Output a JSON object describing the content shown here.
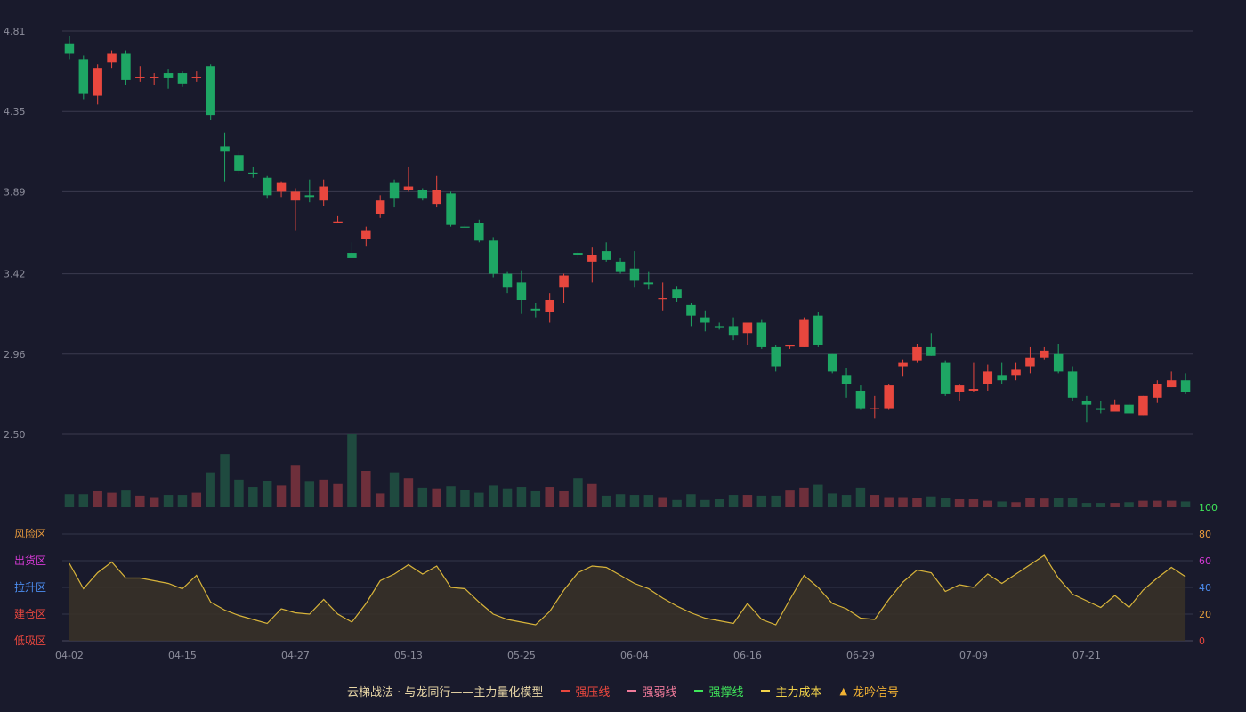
{
  "chart_data": [
    {
      "type": "candlestick",
      "price_axis_ticks": [
        "4.81",
        "4.35",
        "3.89",
        "3.42",
        "2.96",
        "2.50"
      ],
      "ylim": [
        2.5,
        4.81
      ],
      "x_tick_labels": [
        "04-02",
        "04-15",
        "04-27",
        "05-13",
        "05-25",
        "06-04",
        "06-16",
        "06-29",
        "07-09",
        "07-21"
      ],
      "x_tick_bar_index": [
        0,
        8,
        16,
        24,
        32,
        40,
        48,
        56,
        64,
        72
      ],
      "colors": {
        "up": "#e8473e",
        "down": "#1ea664",
        "vol_up": "#6e2f3b",
        "vol_down": "#1f4a3f"
      },
      "bars": [
        [
          4.74,
          4.68,
          4.78,
          4.65,
          0
        ],
        [
          4.65,
          4.45,
          4.67,
          4.42,
          0
        ],
        [
          4.44,
          4.6,
          4.62,
          4.39,
          1
        ],
        [
          4.63,
          4.68,
          4.7,
          4.6,
          1
        ],
        [
          4.68,
          4.53,
          4.7,
          4.5,
          0
        ],
        [
          4.54,
          4.55,
          4.61,
          4.52,
          1
        ],
        [
          4.54,
          4.55,
          4.57,
          4.5,
          1
        ],
        [
          4.57,
          4.54,
          4.59,
          4.48,
          0
        ],
        [
          4.57,
          4.51,
          4.58,
          4.49,
          0
        ],
        [
          4.54,
          4.55,
          4.58,
          4.52,
          1
        ],
        [
          4.61,
          4.33,
          4.62,
          4.3,
          0
        ],
        [
          4.15,
          4.12,
          4.23,
          3.95,
          0
        ],
        [
          4.1,
          4.01,
          4.12,
          3.99,
          0
        ],
        [
          4.0,
          3.99,
          4.03,
          3.97,
          0
        ],
        [
          3.97,
          3.87,
          3.98,
          3.85,
          0
        ],
        [
          3.89,
          3.94,
          3.95,
          3.86,
          1
        ],
        [
          3.84,
          3.89,
          3.91,
          3.67,
          1
        ],
        [
          3.87,
          3.86,
          3.96,
          3.83,
          0
        ],
        [
          3.84,
          3.92,
          3.96,
          3.81,
          1
        ],
        [
          3.71,
          3.72,
          3.75,
          3.71,
          1
        ],
        [
          3.54,
          3.51,
          3.6,
          3.51,
          0
        ],
        [
          3.62,
          3.67,
          3.69,
          3.58,
          1
        ],
        [
          3.76,
          3.84,
          3.87,
          3.74,
          1
        ],
        [
          3.85,
          3.94,
          3.96,
          3.8,
          0
        ],
        [
          3.9,
          3.92,
          4.03,
          3.89,
          1
        ],
        [
          3.9,
          3.85,
          3.91,
          3.84,
          0
        ],
        [
          3.82,
          3.9,
          3.98,
          3.8,
          1
        ],
        [
          3.88,
          3.7,
          3.89,
          3.69,
          0
        ],
        [
          3.69,
          3.69,
          3.7,
          3.69,
          0
        ],
        [
          3.71,
          3.61,
          3.73,
          3.6,
          0
        ],
        [
          3.61,
          3.42,
          3.63,
          3.4,
          0
        ],
        [
          3.42,
          3.34,
          3.43,
          3.31,
          0
        ],
        [
          3.37,
          3.27,
          3.44,
          3.19,
          0
        ],
        [
          3.22,
          3.21,
          3.25,
          3.17,
          0
        ],
        [
          3.2,
          3.27,
          3.31,
          3.14,
          1
        ],
        [
          3.34,
          3.41,
          3.42,
          3.25,
          1
        ],
        [
          3.54,
          3.53,
          3.55,
          3.51,
          0
        ],
        [
          3.49,
          3.53,
          3.57,
          3.37,
          1
        ],
        [
          3.55,
          3.5,
          3.6,
          3.49,
          0
        ],
        [
          3.49,
          3.43,
          3.51,
          3.42,
          0
        ],
        [
          3.45,
          3.38,
          3.55,
          3.34,
          0
        ],
        [
          3.37,
          3.36,
          3.43,
          3.33,
          0
        ],
        [
          3.28,
          3.28,
          3.37,
          3.21,
          1
        ],
        [
          3.33,
          3.28,
          3.35,
          3.26,
          0
        ],
        [
          3.24,
          3.18,
          3.25,
          3.12,
          0
        ],
        [
          3.17,
          3.14,
          3.21,
          3.09,
          0
        ],
        [
          3.12,
          3.12,
          3.14,
          3.1,
          0
        ],
        [
          3.12,
          3.07,
          3.17,
          3.04,
          0
        ],
        [
          3.08,
          3.14,
          3.14,
          3.01,
          1
        ],
        [
          3.14,
          3.0,
          3.16,
          2.99,
          0
        ],
        [
          3.0,
          2.89,
          3.01,
          2.86,
          0
        ],
        [
          3.01,
          3.01,
          3.01,
          2.99,
          1
        ],
        [
          3.0,
          3.16,
          3.17,
          3.0,
          1
        ],
        [
          3.18,
          3.01,
          3.2,
          3.0,
          0
        ],
        [
          2.96,
          2.86,
          2.96,
          2.85,
          0
        ],
        [
          2.84,
          2.79,
          2.88,
          2.71,
          0
        ],
        [
          2.75,
          2.65,
          2.78,
          2.64,
          0
        ],
        [
          2.65,
          2.65,
          2.72,
          2.59,
          1
        ],
        [
          2.65,
          2.78,
          2.79,
          2.64,
          1
        ],
        [
          2.89,
          2.91,
          2.93,
          2.83,
          1
        ],
        [
          2.92,
          3.0,
          3.02,
          2.91,
          1
        ],
        [
          3.0,
          2.95,
          3.08,
          2.95,
          0
        ],
        [
          2.91,
          2.73,
          2.92,
          2.72,
          0
        ],
        [
          2.74,
          2.78,
          2.79,
          2.69,
          1
        ],
        [
          2.76,
          2.75,
          2.91,
          2.74,
          1
        ],
        [
          2.79,
          2.86,
          2.9,
          2.75,
          1
        ],
        [
          2.84,
          2.81,
          2.91,
          2.79,
          0
        ],
        [
          2.84,
          2.87,
          2.91,
          2.81,
          1
        ],
        [
          2.89,
          2.94,
          3.0,
          2.85,
          1
        ],
        [
          2.94,
          2.98,
          3.0,
          2.93,
          1
        ],
        [
          2.96,
          2.86,
          3.02,
          2.85,
          0
        ],
        [
          2.86,
          2.71,
          2.89,
          2.69,
          0
        ],
        [
          2.69,
          2.67,
          2.72,
          2.57,
          0
        ],
        [
          2.65,
          2.64,
          2.69,
          2.62,
          0
        ],
        [
          2.63,
          2.67,
          2.7,
          2.63,
          1
        ],
        [
          2.67,
          2.62,
          2.68,
          2.62,
          0
        ],
        [
          2.61,
          2.72,
          2.72,
          2.61,
          1
        ],
        [
          2.71,
          2.79,
          2.81,
          2.68,
          1
        ],
        [
          2.77,
          2.81,
          2.86,
          2.77,
          1
        ],
        [
          2.81,
          2.74,
          2.85,
          2.73,
          0
        ]
      ],
      "volume": [
        18,
        18,
        22,
        20,
        23,
        16,
        14,
        17,
        17,
        20,
        48,
        73,
        38,
        28,
        36,
        30,
        57,
        35,
        38,
        32,
        100,
        50,
        19,
        48,
        40,
        27,
        26,
        29,
        24,
        20,
        30,
        26,
        28,
        22,
        28,
        22,
        40,
        32,
        16,
        18,
        17,
        17,
        14,
        10,
        18,
        10,
        11,
        17,
        17,
        16,
        16,
        23,
        27,
        31,
        19,
        17,
        27,
        17,
        14,
        14,
        13,
        15,
        13,
        11,
        11,
        9,
        8,
        7,
        13,
        12,
        13,
        13,
        6,
        6,
        6,
        7,
        9,
        9,
        9,
        8
      ]
    },
    {
      "type": "line",
      "ylim": [
        0,
        100
      ],
      "y_ticks": [
        "0",
        "20",
        "40",
        "60",
        "80",
        "100"
      ],
      "y_tick_colors": [
        "#e8473e",
        "#e8a13c",
        "#4c8df0",
        "#d63ad6",
        "#e89a3c",
        "#3fe65a"
      ],
      "zone_labels": [
        "风险区",
        "出货区",
        "拉升区",
        "建仓区",
        "低吸区"
      ],
      "zone_colors": [
        "#e89a3c",
        "#d63ad6",
        "#4c8df0",
        "#e8473e",
        "#e8473e"
      ],
      "line_color": "#d8b43a",
      "values": [
        58,
        39,
        51,
        59,
        47,
        47,
        45,
        43,
        39,
        49,
        29,
        23,
        19,
        16,
        13,
        24,
        21,
        20,
        31,
        20,
        14,
        28,
        45,
        50,
        57,
        50,
        56,
        40,
        39,
        29,
        20,
        16,
        14,
        12,
        22,
        38,
        51,
        56,
        55,
        49,
        43,
        39,
        32,
        26,
        21,
        17,
        15,
        13,
        28,
        16,
        12,
        31,
        49,
        40,
        28,
        24,
        17,
        16,
        31,
        44,
        53,
        51,
        37,
        42,
        40,
        50,
        43,
        50,
        57,
        64,
        47,
        35,
        30,
        25,
        34,
        25,
        38,
        47,
        55,
        48
      ]
    }
  ],
  "legend": {
    "title": "云梯战法 · 与龙同行——主力量化模型",
    "items": [
      {
        "label": "强压线",
        "color": "#e8473e",
        "style": "solid"
      },
      {
        "label": "强弱线",
        "color": "#f07a9a",
        "style": "dash"
      },
      {
        "label": "强撑线",
        "color": "#3fe65a",
        "style": "solid"
      },
      {
        "label": "主力成本",
        "color": "#f2d24a",
        "style": "dash"
      },
      {
        "label": "龙吟信号",
        "color": "#f2b233",
        "style": "triangle"
      }
    ]
  }
}
